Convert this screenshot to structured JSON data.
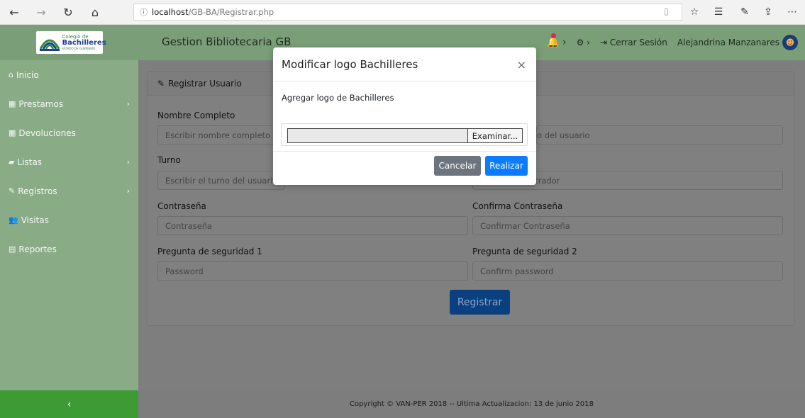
{
  "browser": {
    "url_info_icon": "ⓘ",
    "url_host": "localhost",
    "url_path": "/GB-BA/Registrar.php",
    "icons": [
      "back-icon",
      "forward-icon",
      "refresh-icon",
      "home-icon",
      "reading-view-icon",
      "favorite-icon",
      "favorites-hub-icon",
      "pen-icon",
      "share-icon",
      "more-icon"
    ]
  },
  "header": {
    "logo_line1": "Colegio de",
    "logo_line2": "Bachilleres",
    "logo_line3": "ESTADO DE GUERRERO",
    "app_title": "Gestion Bibliotecaria GB",
    "logout_label": "Cerrar Sesión",
    "user_name": "Alejandrina Manzanares"
  },
  "sidebar": {
    "items": [
      {
        "label": "Inicio",
        "icon": "home-icon"
      },
      {
        "label": "Prestamos",
        "icon": "calendar-icon",
        "has_children": true
      },
      {
        "label": "Devoluciones",
        "icon": "calendar-icon"
      },
      {
        "label": "Listas",
        "icon": "book-icon",
        "has_children": true
      },
      {
        "label": "Registros",
        "icon": "edit-icon",
        "has_children": true
      },
      {
        "label": "Visitas",
        "icon": "users-icon"
      },
      {
        "label": "Reportes",
        "icon": "file-icon"
      }
    ],
    "collapse_label": "‹"
  },
  "form": {
    "card_title": "Registrar Usuario",
    "fields": {
      "nombre_label": "Nombre Completo",
      "nombre_placeholder": "Escribir nombre completo",
      "usuario_placeholder_partial": "o del usuario",
      "turno_label": "Turno",
      "turno_placeholder": "Escribir el turno del usuario",
      "admin_placeholder_partial": "istrador",
      "pass_label": "Contraseña",
      "pass_placeholder": "Contraseña",
      "confirm_label": "Confirma Contraseña",
      "confirm_placeholder": "Confirmar Contraseña",
      "q1_label": "Pregunta de seguridad 1",
      "q1_placeholder": "Password",
      "q2_label": "Pregunta de seguridad 2",
      "q2_placeholder": "Confirm password"
    },
    "submit_label": "Registrar"
  },
  "footer": {
    "text": "Copyright © VAN-PER 2018 -- Ultima Actualizacion: 13 de junio 2018"
  },
  "modal": {
    "title": "Modificar logo Bachilleres",
    "close_label": "×",
    "body_text": "Agregar logo de Bachilleres",
    "file_button": "Examinar...",
    "cancel_label": "Cancelar",
    "submit_label": "Realizar"
  },
  "colors": {
    "header_green": "#7a9e77",
    "sidebar_green": "#89ac86",
    "footer_green": "#3c9b35",
    "primary_blue": "#0b7bff",
    "secondary_gray": "#6c757d"
  }
}
